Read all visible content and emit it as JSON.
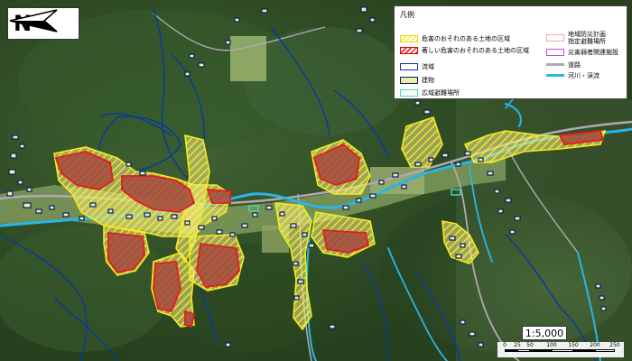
{
  "map": {
    "north_label": "N",
    "scale_ratio": "1:5,000",
    "scale_ticks": [
      "0",
      "25",
      "50",
      "100",
      "150",
      "200",
      "250"
    ]
  },
  "legend": {
    "title": "凡例",
    "hazard_area": "危害のおそれのある土地の区域",
    "severe_hazard_area": "著しい危害のおそれのある土地の区域",
    "basin": "流域",
    "building": "建物",
    "wide_evacuation": "広域避難場所",
    "local_plan_line1": "地域防災計画",
    "local_plan_line2": "指定避難場所",
    "disaster_facility": "災害弱者関連施設",
    "road": "道路",
    "river": "河川・渓流"
  },
  "colors": {
    "forest": "#2e4a24",
    "hazard_fill": "#ffee66",
    "hazard_outline": "#e0e000",
    "severe_fill": "#b04545",
    "severe_outline": "#e00000",
    "basin": "#0a3a9a",
    "building": "#0a1a70",
    "river": "#27b6e6",
    "road": "#b0a8b4"
  }
}
